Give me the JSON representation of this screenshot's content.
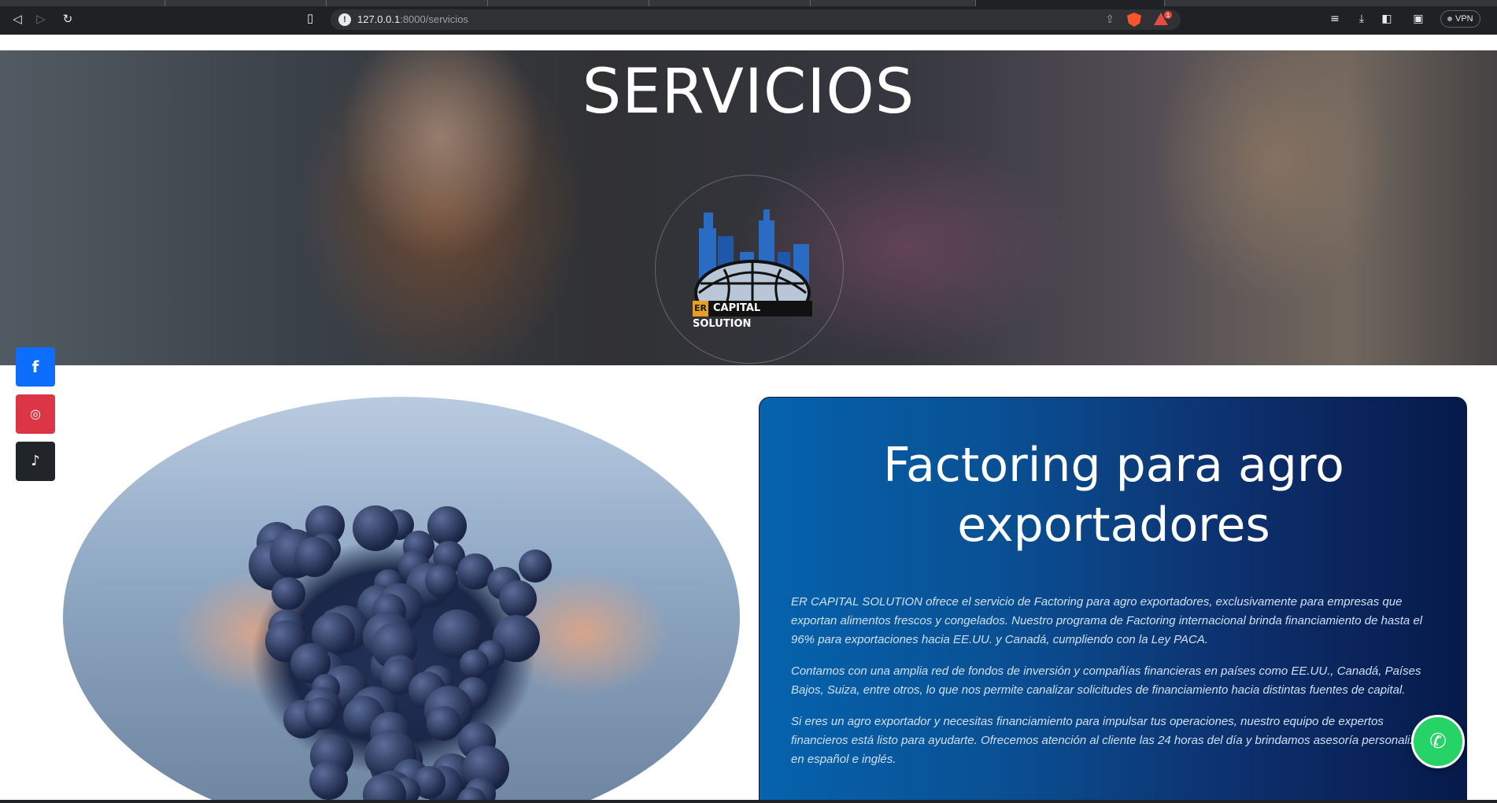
{
  "browser": {
    "url_host": "127.0.0.1",
    "url_path": ":8000/servicios",
    "vpn_label": "VPN",
    "rewards_badge": "1"
  },
  "hero": {
    "title": "SERVICIOS",
    "logo_er": "ER",
    "logo_name": "CAPITAL SOLUTION"
  },
  "social": {
    "facebook_icon": "f",
    "instagram_icon": "◎",
    "tiktok_icon": "♪"
  },
  "card": {
    "title": "Factoring para agro exportadores",
    "paragraphs": [
      "ER CAPITAL SOLUTION ofrece el servicio de Factoring para agro exportadores, exclusivamente para empresas que exportan alimentos frescos y congelados. Nuestro programa de Factoring internacional brinda financiamiento de hasta el 96% para exportaciones hacia EE.UU. y Canadá, cumpliendo con la Ley PACA.",
      "Contamos con una amplia red de fondos de inversión y compañías financieras en países como EE.UU., Canadá, Países Bajos, Suiza, entre otros, lo que nos permite canalizar solicitudes de financiamiento hacia distintas fuentes de capital.",
      "Si eres un agro exportador y necesitas financiamiento para impulsar tus operaciones, nuestro equipo de expertos financieros está listo para ayudarte. Ofrecemos atención al cliente las 24 horas del día y brindamos asesoría personalizada en español e inglés."
    ]
  },
  "whatsapp": {
    "icon": "✆"
  },
  "colors": {
    "facebook": "#0d6efd",
    "instagram": "#dc3545",
    "tiktok": "#212529",
    "whatsapp": "#25d366",
    "card_start": "#0563ad",
    "card_end": "#061a4a"
  }
}
